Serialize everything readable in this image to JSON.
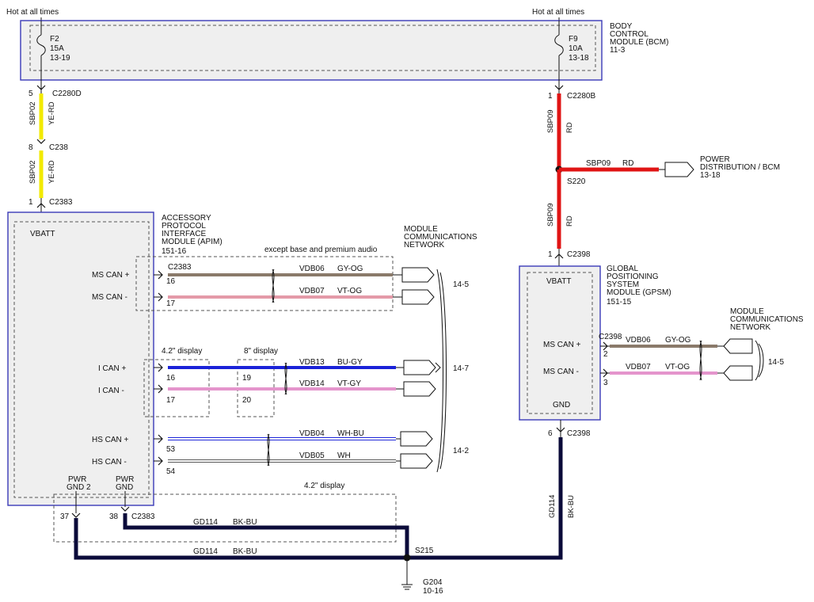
{
  "colors": {
    "module_fill": "#efefef",
    "module_border": "#3a3ab8",
    "wire_yellow": "#f2ea00",
    "wire_red": "#e01414",
    "wire_gray": "#8a7a6a",
    "wire_pink": "#e49aa8",
    "wire_blue": "#1a22d8",
    "wire_violet": "#e494cc",
    "wire_black": "#0b0b3a",
    "dash": "#555555"
  },
  "power": {
    "left_label": "Hot at all times",
    "right_label": "Hot at all times"
  },
  "bcm": {
    "title_lines": [
      "BODY",
      "CONTROL",
      "MODULE (BCM)",
      "11-3"
    ],
    "fuse_left": [
      "F2",
      "15A",
      "13-19"
    ],
    "fuse_right": [
      "F9",
      "10A",
      "13-18"
    ]
  },
  "left_feed": {
    "pin1": "5",
    "conn1": "C2280D",
    "wire1_circuit": "SBP02",
    "wire1_color": "YE-RD",
    "pin2": "8",
    "conn2": "C238",
    "wire2_circuit": "SBP02",
    "wire2_color": "YE-RD",
    "pin3": "1",
    "conn3": "C2383"
  },
  "right_feed": {
    "pin1": "1",
    "conn1": "C2280B",
    "wire1_circuit": "SBP09",
    "wire1_color": "RD",
    "branch_circuit": "SBP09",
    "branch_color": "RD",
    "splice": "S220",
    "power_dist": [
      "POWER",
      "DISTRIBUTION / BCM",
      "13-18"
    ],
    "wire2_circuit": "SBP09",
    "wire2_color": "RD",
    "pin2": "1",
    "conn2": "C2398"
  },
  "apim": {
    "title_lines": [
      "ACCESSORY",
      "PROTOCOL",
      "INTERFACE",
      "MODULE (APIM)",
      "151-16"
    ],
    "vbatt": "VBATT",
    "except_note": "except base and premium audio",
    "conn": "C2383",
    "ms_can_plus": "MS CAN +",
    "ms_can_minus": "MS CAN -",
    "i_can_plus": "I CAN +",
    "i_can_minus": "I CAN -",
    "hs_can_plus": "HS CAN +",
    "hs_can_minus": "HS CAN -",
    "pins": {
      "ms_plus": "16",
      "ms_minus": "17",
      "i_plus": "16",
      "i_minus": "17",
      "hs_plus": "53",
      "hs_minus": "54",
      "pin19": "19",
      "pin20": "20"
    },
    "display_42": "4.2\" display",
    "display_8": "8\" display",
    "display_42_bottom": "4.2\" display",
    "pwr_gnd2": [
      "PWR",
      "GND 2"
    ],
    "pwr_gnd": [
      "PWR",
      "GND"
    ],
    "gnd_pin_a": "37",
    "gnd_pin_b": "38",
    "gnd_conn": "C2383"
  },
  "network_left": {
    "title_lines": [
      "MODULE",
      "COMMUNICATIONS",
      "NETWORK"
    ],
    "ms": [
      {
        "circuit": "VDB06",
        "color": "GY-OG"
      },
      {
        "circuit": "VDB07",
        "color": "VT-OG"
      }
    ],
    "i": [
      {
        "circuit": "VDB13",
        "color": "BU-GY"
      },
      {
        "circuit": "VDB14",
        "color": "VT-GY"
      }
    ],
    "hs": [
      {
        "circuit": "VDB04",
        "color": "WH-BU"
      },
      {
        "circuit": "VDB05",
        "color": "WH"
      }
    ],
    "ref_ms": "14-5",
    "ref_i": "14-7",
    "ref_hs": "14-2"
  },
  "gpsm": {
    "title_lines": [
      "GLOBAL",
      "POSITIONING",
      "SYSTEM",
      "MODULE (GPSM)",
      "151-15"
    ],
    "vbatt": "VBATT",
    "ms_can_plus": "MS CAN +",
    "ms_can_minus": "MS CAN -",
    "gnd": "GND",
    "conn": "C2398",
    "pin_plus": "2",
    "pin_minus": "3",
    "gnd_pin": "6",
    "gnd_conn": "C2398"
  },
  "network_right": {
    "title_lines": [
      "MODULE",
      "COMMUNICATIONS",
      "NETWORK"
    ],
    "ms": [
      {
        "circuit": "VDB06",
        "color": "GY-OG"
      },
      {
        "circuit": "VDB07",
        "color": "VT-OG"
      }
    ],
    "ref": "14-5"
  },
  "ground": {
    "wire_upper": {
      "circuit": "GD114",
      "color": "BK-BU"
    },
    "wire_lower": {
      "circuit": "GD114",
      "color": "BK-BU"
    },
    "wire_right": {
      "circuit": "GD114",
      "color": "BK-BU"
    },
    "splice": "S215",
    "ground_point": "G204",
    "ground_ref": "10-16"
  }
}
